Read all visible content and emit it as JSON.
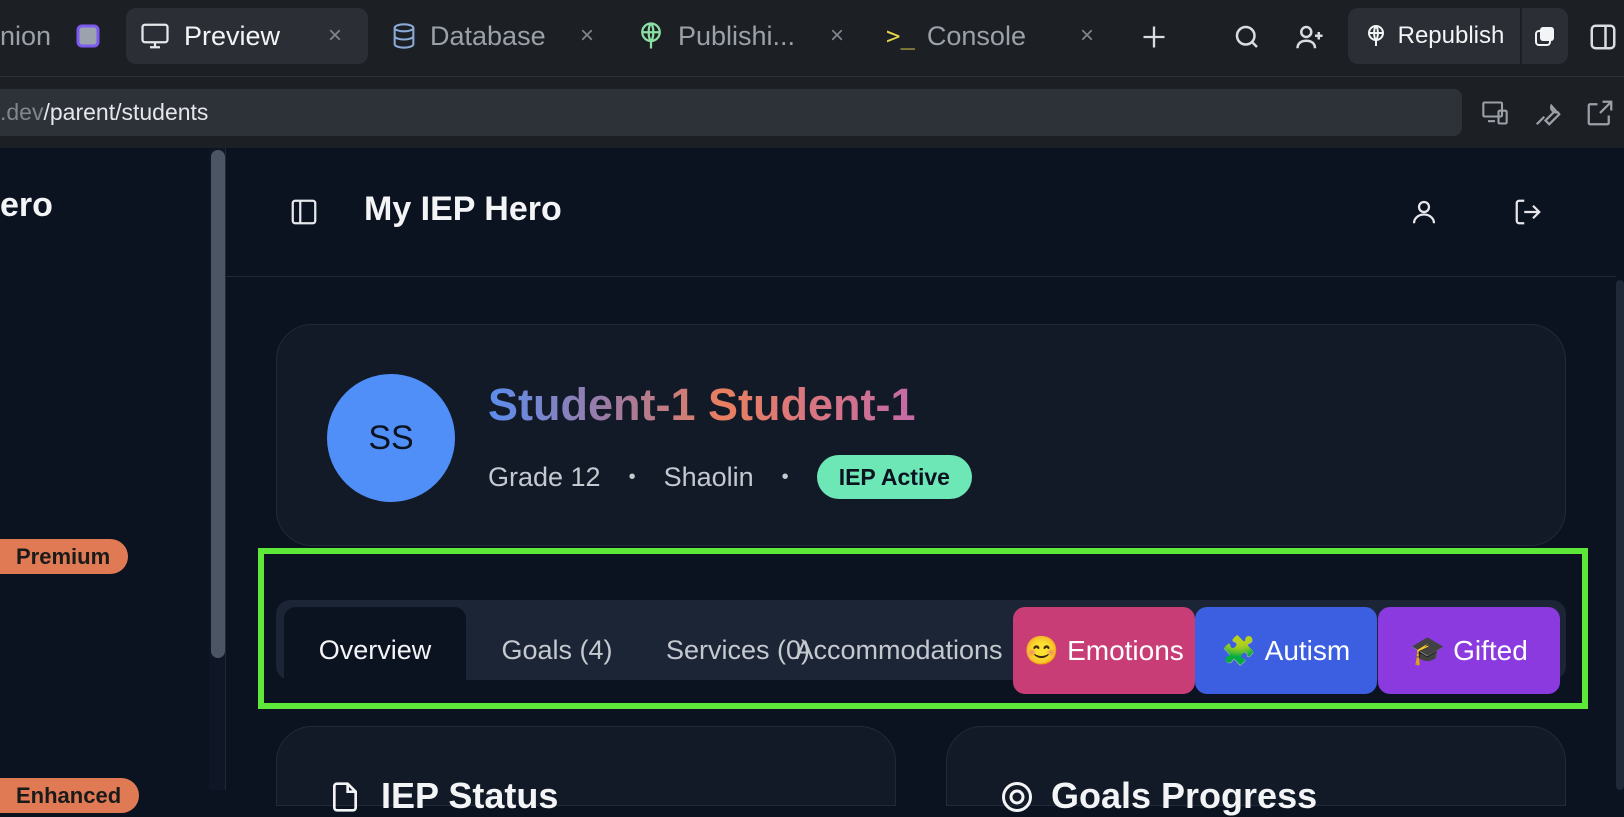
{
  "ide": {
    "tabs": [
      {
        "label": "nion",
        "icon": "app-square-icon"
      },
      {
        "label": "Preview",
        "icon": "monitor-icon",
        "active": true
      },
      {
        "label": "Database",
        "icon": "database-icon"
      },
      {
        "label": "Publishi...",
        "icon": "globe-publish-icon"
      },
      {
        "label": "Console",
        "icon": "terminal-icon"
      }
    ],
    "close_glyph": "×",
    "republish_label": "Republish",
    "url_domain": ".dev",
    "url_path": "/parent/students"
  },
  "sidebar": {
    "title": "ero",
    "badges": [
      {
        "label": "Premium",
        "color": "#e07a55"
      },
      {
        "label": "Enhanced",
        "color": "#e07a55"
      }
    ]
  },
  "header": {
    "title": "My IEP Hero"
  },
  "student": {
    "initials": "SS",
    "name": "Student-1 Student-1",
    "grade": "Grade 12",
    "school": "Shaolin",
    "status": "IEP Active"
  },
  "tabs": {
    "overview": "Overview",
    "goals": "Goals (4)",
    "services": "Services (0)",
    "accommodations": "Accommodations",
    "emotions": {
      "label": "Emotions",
      "emoji": "😊",
      "color": "#c93d76"
    },
    "autism": {
      "label": "Autism",
      "emoji": "🧩",
      "color": "#3b5fe0"
    },
    "gifted": {
      "label": "Gifted",
      "emoji": "🎓",
      "color": "#8b3ae0"
    }
  },
  "cards": {
    "left_title": "IEP Status",
    "right_title": "Goals Progress"
  },
  "colors": {
    "highlight": "#5de83a",
    "avatar": "#4f8ff7",
    "status_badge": "#6ee7b7"
  }
}
